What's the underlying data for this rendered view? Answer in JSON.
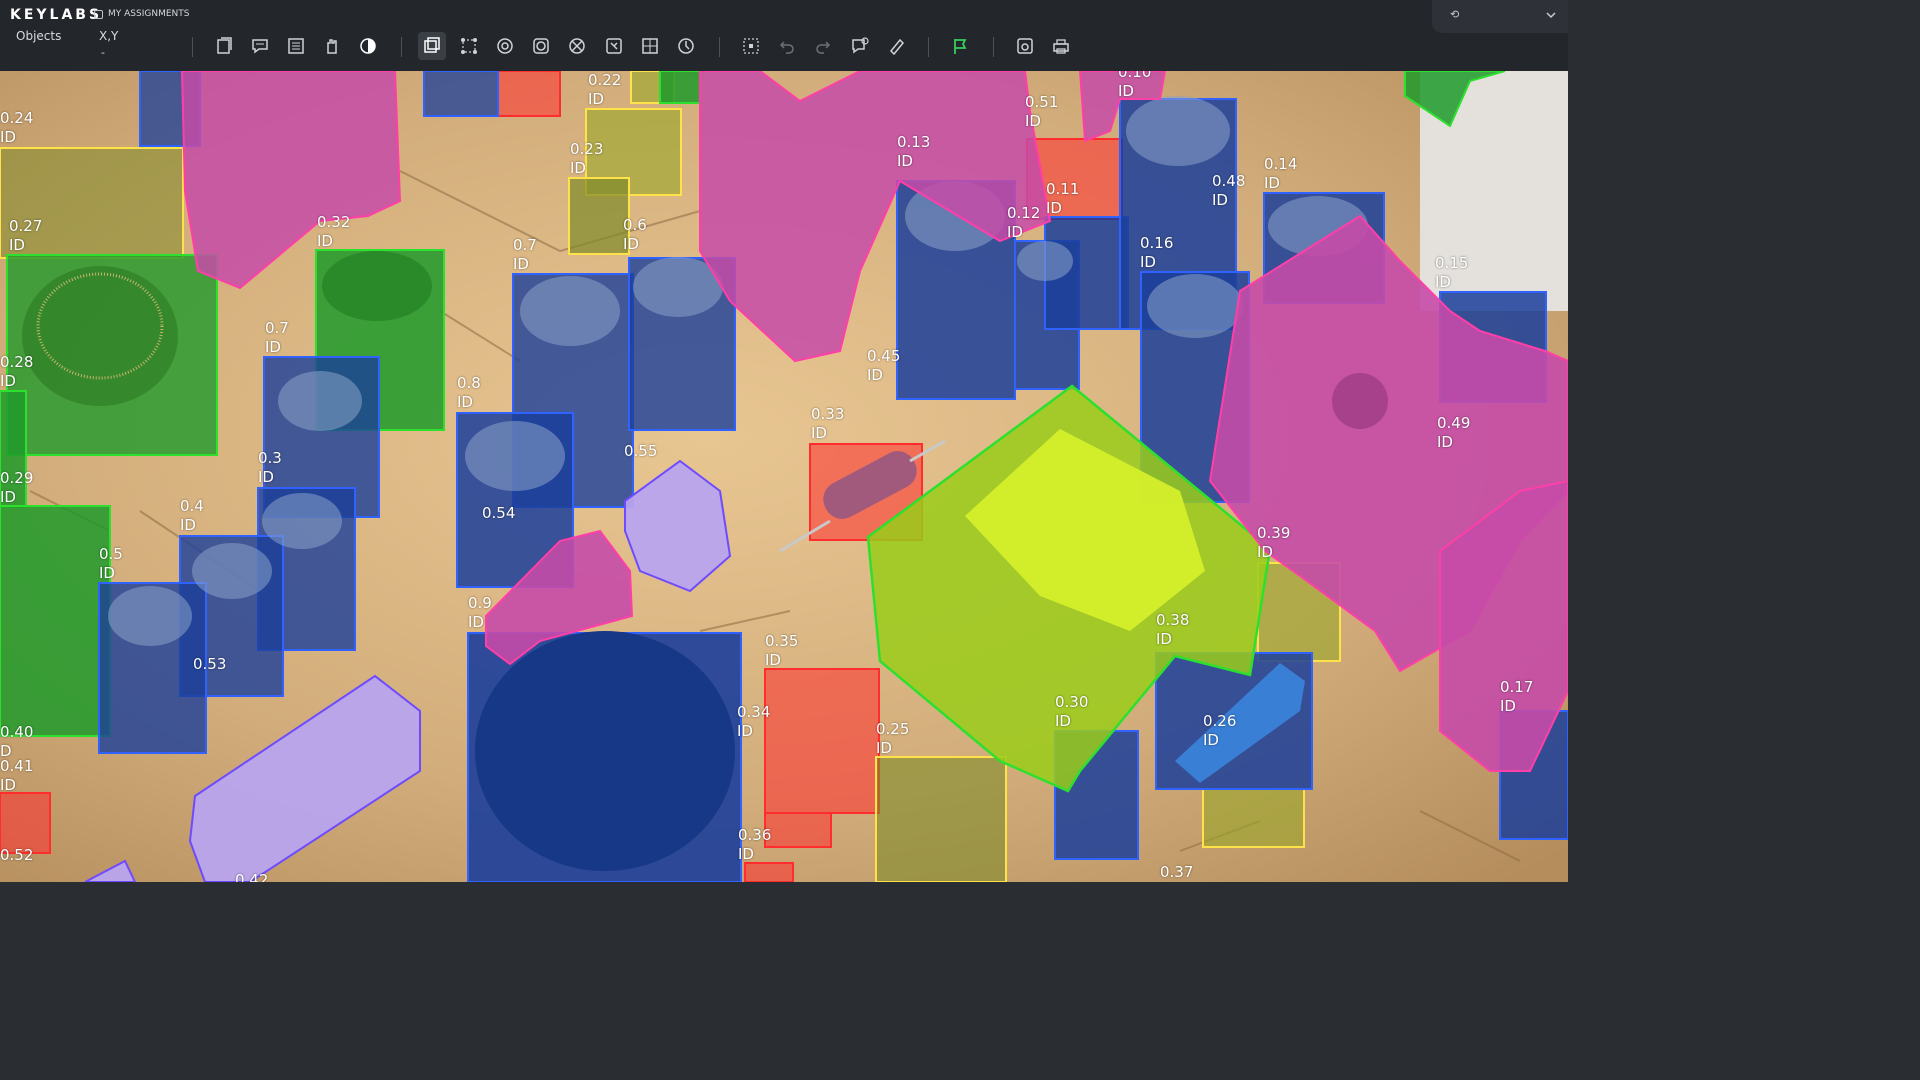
{
  "app": {
    "brand": "KEYLABS",
    "assignments_label": "MY ASSIGNMENTS",
    "objects_tab": "Objects",
    "xy_label": "X,Y",
    "xy_value": "-"
  },
  "colors": {
    "topbar": "#23272c",
    "blue": "#2f62ff",
    "green": "#2ee02e",
    "magenta": "#ff3fa8",
    "red": "#ff2d2d",
    "yellow": "#ffe14a",
    "purple": "#6e4bff",
    "lime": "#b8ea1d"
  },
  "toolbar": {
    "group1": [
      "object-properties-icon",
      "comment-icon",
      "list-icon",
      "hand-tool-icon",
      "contrast-icon"
    ],
    "group2": [
      "bounding-box-icon",
      "polygon-icon",
      "ellipse-icon",
      "brush-icon",
      "mask-icon",
      "magic-wand-icon",
      "grid-icon",
      "rotate-icon"
    ],
    "group3": [
      "select-area-icon",
      "undo-icon",
      "redo-icon",
      "add-comment-icon",
      "eraser-icon"
    ],
    "group4": [
      "flag-icon"
    ],
    "group5": [
      "save-icon",
      "print-icon"
    ]
  },
  "dropdown": {
    "value": "⟲"
  },
  "labels": [
    {
      "id": "l024",
      "score": "0.24",
      "tag": "ID"
    },
    {
      "id": "l027",
      "score": "0.27",
      "tag": "ID"
    },
    {
      "id": "l028",
      "score": "0.28",
      "tag": "ID"
    },
    {
      "id": "l029",
      "score": "0.29",
      "tag": "ID"
    },
    {
      "id": "l040",
      "score": "0.40",
      "tag": "D"
    },
    {
      "id": "l041",
      "score": "0.41",
      "tag": "ID"
    },
    {
      "id": "l052",
      "score": "0.52",
      "tag": ""
    },
    {
      "id": "l032",
      "score": "0.32",
      "tag": "ID"
    },
    {
      "id": "l07a",
      "score": "0.7",
      "tag": "ID"
    },
    {
      "id": "l03",
      "score": "0.3",
      "tag": "ID"
    },
    {
      "id": "l04",
      "score": "0.4",
      "tag": "ID"
    },
    {
      "id": "l05",
      "score": "0.5",
      "tag": "ID"
    },
    {
      "id": "l053",
      "score": "0.53",
      "tag": ""
    },
    {
      "id": "l022",
      "score": "0.22",
      "tag": "ID"
    },
    {
      "id": "l023",
      "score": "0.23",
      "tag": "ID"
    },
    {
      "id": "l06",
      "score": "0.6",
      "tag": "ID"
    },
    {
      "id": "l07b",
      "score": "0.7",
      "tag": "ID"
    },
    {
      "id": "l08",
      "score": "0.8",
      "tag": "ID"
    },
    {
      "id": "l054",
      "score": "0.54",
      "tag": ""
    },
    {
      "id": "l055",
      "score": "0.55",
      "tag": ""
    },
    {
      "id": "l09",
      "score": "0.9",
      "tag": "ID"
    },
    {
      "id": "l043",
      "score": "0.42",
      "tag": ""
    },
    {
      "id": "l010",
      "score": "0.10",
      "tag": "ID"
    },
    {
      "id": "l051",
      "score": "0.51",
      "tag": "ID"
    },
    {
      "id": "l013",
      "score": "0.13",
      "tag": "ID"
    },
    {
      "id": "l011",
      "score": "0.11",
      "tag": "ID"
    },
    {
      "id": "l012",
      "score": "0.12",
      "tag": "ID"
    },
    {
      "id": "l048",
      "score": "0.48",
      "tag": "ID"
    },
    {
      "id": "l014",
      "score": "0.14",
      "tag": "ID"
    },
    {
      "id": "l016",
      "score": "0.16",
      "tag": "ID"
    },
    {
      "id": "l015",
      "score": "0.15",
      "tag": "ID"
    },
    {
      "id": "l045",
      "score": "0.45",
      "tag": "ID"
    },
    {
      "id": "l033",
      "score": "0.33",
      "tag": "ID"
    },
    {
      "id": "l049",
      "score": "0.49",
      "tag": "ID"
    },
    {
      "id": "l039",
      "score": "0.39",
      "tag": "ID"
    },
    {
      "id": "l038",
      "score": "0.38",
      "tag": "ID"
    },
    {
      "id": "l035",
      "score": "0.35",
      "tag": "ID"
    },
    {
      "id": "l034",
      "score": "0.34",
      "tag": "ID"
    },
    {
      "id": "l025",
      "score": "0.25",
      "tag": "ID"
    },
    {
      "id": "l030",
      "score": "0.30",
      "tag": "ID"
    },
    {
      "id": "l026",
      "score": "0.26",
      "tag": "ID"
    },
    {
      "id": "l017",
      "score": "0.17",
      "tag": "ID"
    },
    {
      "id": "l036",
      "score": "0.36",
      "tag": "ID"
    },
    {
      "id": "l037",
      "score": "0.37",
      "tag": ""
    }
  ]
}
